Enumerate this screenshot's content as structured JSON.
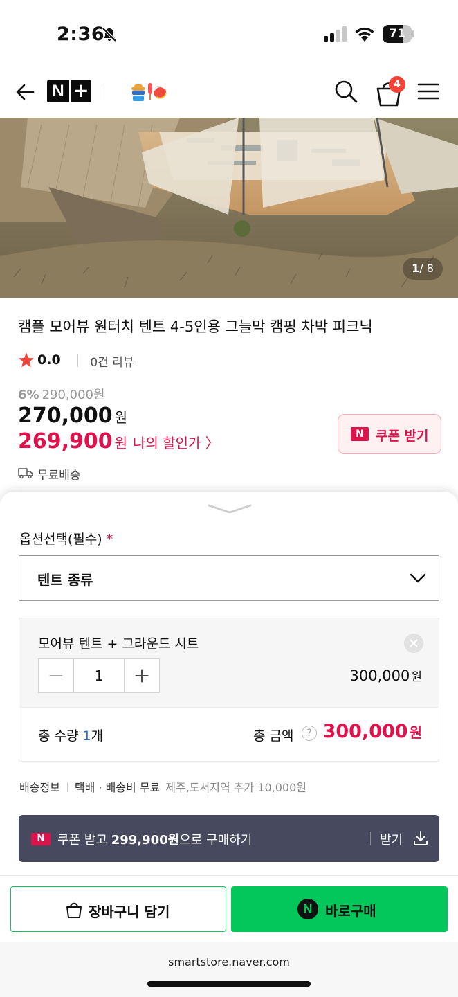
{
  "status_bar": {
    "time": "2:36",
    "battery": "71",
    "battery_level": 0.71
  },
  "header": {
    "brand": "N",
    "brand_plus": "+",
    "cart_count": "4"
  },
  "hero": {
    "counter_current": "1",
    "counter_total": "/ 8"
  },
  "product": {
    "title": "캠플 모어뷰 원터치 텐트 4-5인용 그늘막 캠핑 차박 피크닉",
    "rating": "0.0",
    "reviews": "0건 리뷰",
    "discount_rate": "6%",
    "original_price": "290,000원",
    "sale_price": "270,000",
    "currency": "원",
    "benefit_price": "269,900",
    "benefit_label": "나의 할인가 〉",
    "coupon_button": "쿠폰 받기",
    "shipping": "무료배송"
  },
  "option_sheet": {
    "label": "옵션선택(필수)",
    "required_mark": "*",
    "select_value": "텐트 종류",
    "selected_item": {
      "name": "모어뷰 텐트 + 그라운드 시트",
      "quantity": "1",
      "price": "300,000",
      "price_unit": "원"
    },
    "total_qty_label": "총 수량",
    "total_qty": "1",
    "total_qty_unit": "개",
    "total_amount_label": "총 금액",
    "total_amount": "300,000",
    "total_amount_unit": "원",
    "delivery_label": "배송정보",
    "delivery_value": "택배 · 배송비 무료",
    "delivery_extra": "제주,도서지역 추가 10,000원",
    "coupon_banner_prefix": "쿠폰 받고 ",
    "coupon_banner_amount": "299,900원",
    "coupon_banner_suffix": "으로 구매하기",
    "coupon_banner_action": "받기"
  },
  "actions": {
    "add_to_cart": "장바구니 담기",
    "buy_now": "바로구매"
  },
  "browser": {
    "url": "smartstore.naver.com"
  },
  "colors": {
    "accent_red": "#e0124b",
    "naver_green": "#03c75a",
    "banner_bg": "#474a5e"
  },
  "icons": [
    "bell-slash-icon",
    "signal-icon",
    "wifi-icon",
    "battery-icon",
    "back-arrow-icon",
    "search-icon",
    "shopping-bag-icon",
    "hamburger-menu-icon",
    "star-icon",
    "delivery-truck-icon",
    "chevron-down-icon",
    "close-icon",
    "minus-icon",
    "plus-icon",
    "help-icon",
    "download-icon",
    "naver-n-icon"
  ]
}
